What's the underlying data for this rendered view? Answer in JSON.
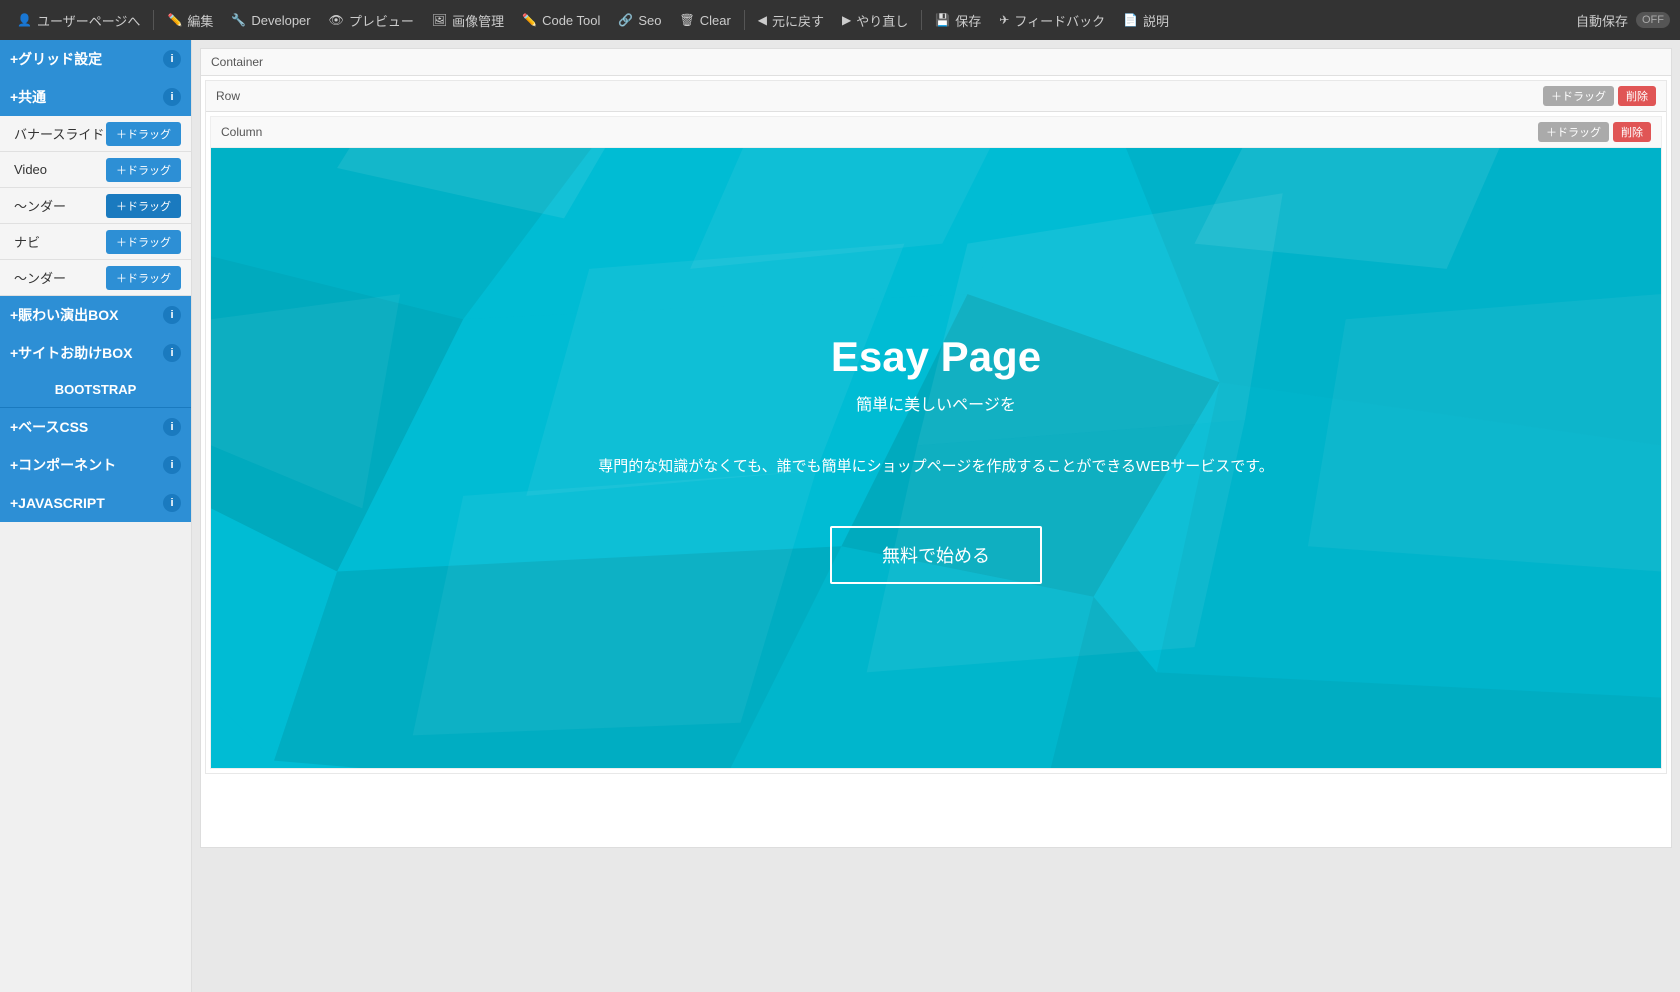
{
  "topbar": {
    "items": [
      {
        "id": "user-page",
        "icon": "👤",
        "label": "ユーザーページへ"
      },
      {
        "id": "edit",
        "icon": "✏️",
        "label": "編集"
      },
      {
        "id": "developer",
        "icon": "🔧",
        "label": "Developer"
      },
      {
        "id": "preview",
        "icon": "👁",
        "label": "プレビュー"
      },
      {
        "id": "image-mgmt",
        "icon": "🖼",
        "label": "画像管理"
      },
      {
        "id": "code-tool",
        "icon": "✏️",
        "label": "Code Tool"
      },
      {
        "id": "seo",
        "icon": "🔗",
        "label": "Seo"
      },
      {
        "id": "clear",
        "icon": "🗑",
        "label": "Clear"
      },
      {
        "id": "undo",
        "icon": "◀",
        "label": "元に戻す"
      },
      {
        "id": "redo",
        "icon": "▶",
        "label": "やり直し"
      },
      {
        "id": "save",
        "icon": "💾",
        "label": "保存"
      },
      {
        "id": "feedback",
        "icon": "✈",
        "label": "フィードバック"
      },
      {
        "id": "help",
        "icon": "📄",
        "label": "説明"
      }
    ],
    "autosave_label": "自動保存",
    "toggle_label": "OFF"
  },
  "sidebar": {
    "sections": [
      {
        "id": "grid-settings",
        "label": "+グリッド設定",
        "collapsible": true,
        "items": []
      },
      {
        "id": "common",
        "label": "+共通",
        "collapsible": true,
        "items": [
          {
            "label": "バナースライド",
            "drag": "＋ドラッグ"
          },
          {
            "label": "Video",
            "drag": "＋ドラッグ"
          },
          {
            "label": "〜ンダー",
            "drag": "＋ドラッグ"
          },
          {
            "label": "ナビ",
            "drag": "＋ドラッグ"
          },
          {
            "label": "〜ンダー",
            "drag": "＋ドラッグ"
          }
        ]
      },
      {
        "id": "animation-box",
        "label": "+賑わい演出BOX",
        "collapsible": true,
        "items": []
      },
      {
        "id": "site-helper-box",
        "label": "+サイトお助けBOX",
        "collapsible": true,
        "items": []
      },
      {
        "id": "bootstrap",
        "label": "BOOTSTRAP",
        "collapsible": false,
        "items": []
      },
      {
        "id": "base-css",
        "label": "+ベースCSS",
        "collapsible": true,
        "items": []
      },
      {
        "id": "component",
        "label": "+コンポーネント",
        "collapsible": true,
        "items": []
      },
      {
        "id": "javascript",
        "label": "+JAVASCRIPT",
        "collapsible": true,
        "items": []
      }
    ]
  },
  "builder": {
    "container_label": "Container",
    "row_label": "Row",
    "column_label": "Column",
    "drag_label": "＋ドラッグ",
    "delete_label": "削除"
  },
  "hero": {
    "title": "Esay Page",
    "subtitle": "簡単に美しいページを",
    "description": "専門的な知識がなくても、誰でも簡単にショップページを作成することができるWEBサービスです。",
    "button_label": "無料で始める"
  }
}
